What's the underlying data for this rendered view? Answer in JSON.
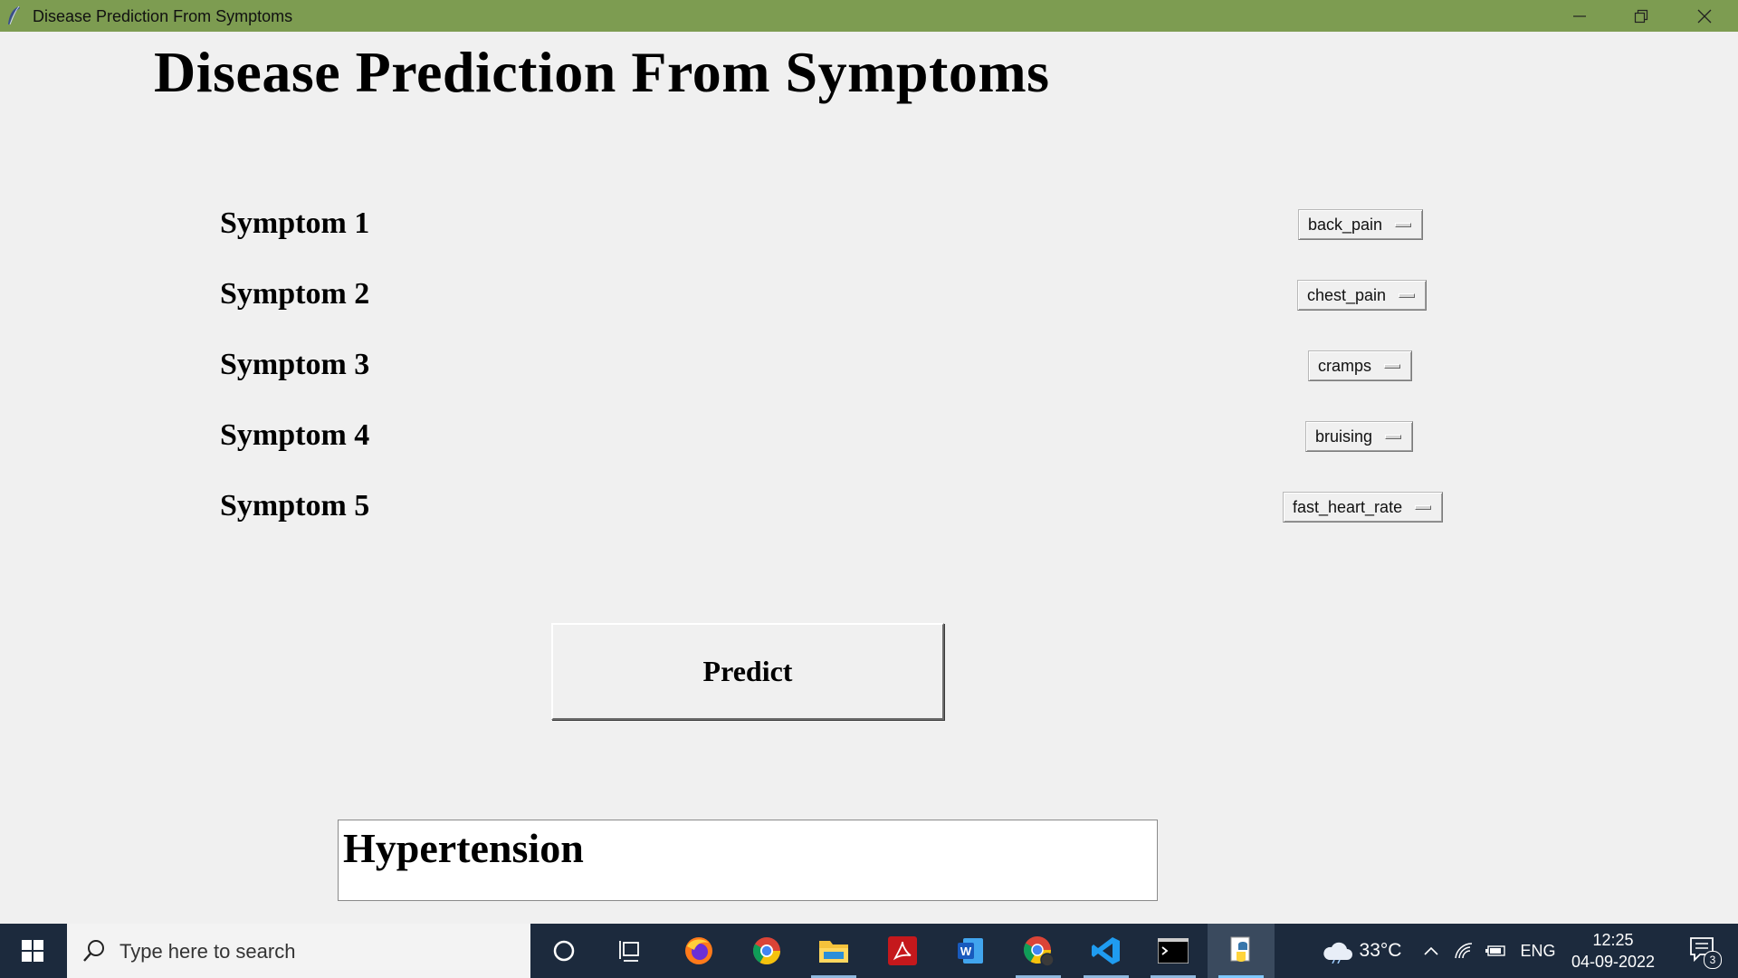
{
  "window": {
    "title": "Disease Prediction From Symptoms",
    "titlebar_color": "#7d9c51"
  },
  "app": {
    "heading": "Disease Prediction From Symptoms",
    "symptoms": [
      {
        "label": "Symptom 1",
        "value": "back_pain"
      },
      {
        "label": "Symptom 2",
        "value": "chest_pain"
      },
      {
        "label": "Symptom 3",
        "value": "cramps"
      },
      {
        "label": "Symptom 4",
        "value": "bruising"
      },
      {
        "label": "Symptom 5",
        "value": "fast_heart_rate"
      }
    ],
    "predict_label": "Predict",
    "result": "Hypertension"
  },
  "taskbar": {
    "search_placeholder": "Type here to search",
    "apps": [
      "cortana-icon",
      "task-view-icon",
      "firefox-icon",
      "chrome-icon",
      "file-explorer-icon",
      "acrobat-icon",
      "word-icon",
      "chrome-profile-icon",
      "vscode-icon",
      "terminal-icon",
      "python-icon"
    ],
    "weather": "33°C",
    "language": "ENG",
    "time": "12:25",
    "date": "04-09-2022",
    "notification_count": "3",
    "background": "#1c2a3d"
  }
}
